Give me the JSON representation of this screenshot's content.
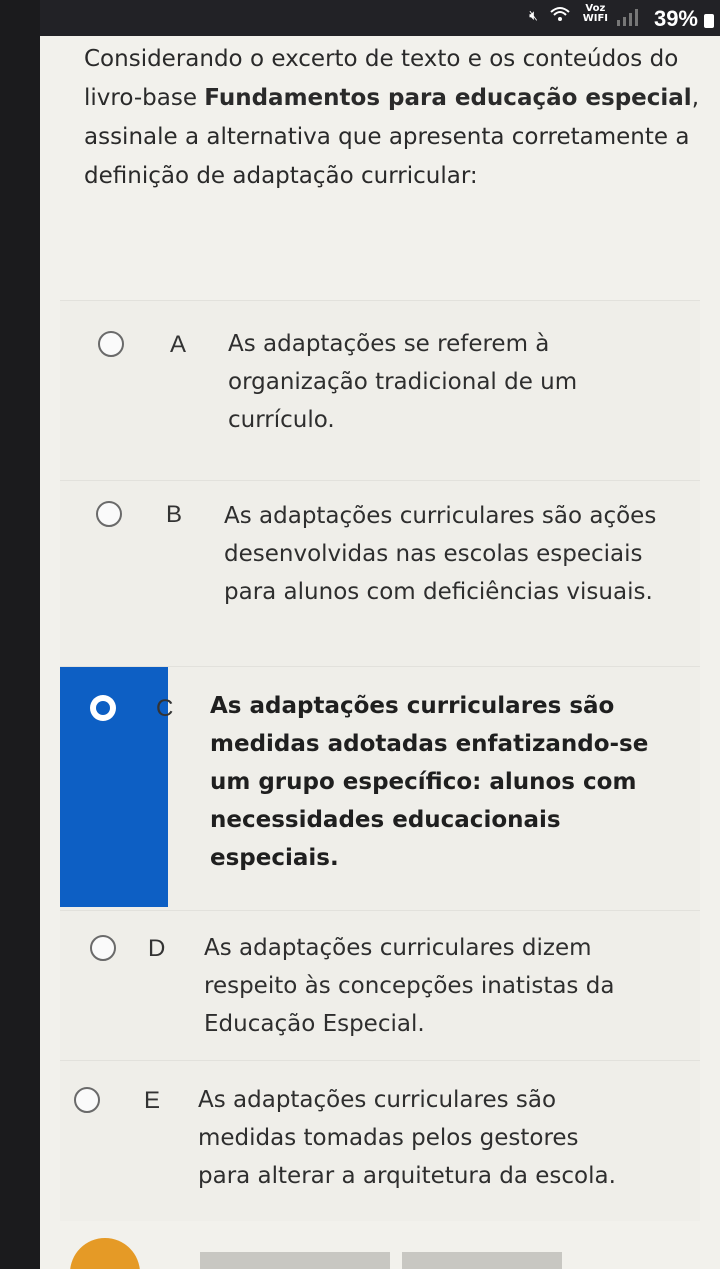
{
  "status": {
    "voz_label": "Voz",
    "wifi_label": "WIFI",
    "battery": "39%"
  },
  "question": {
    "part1": "Considerando o excerto de texto e os conteúdos do livro-base ",
    "book": "Fundamentos para educação especial",
    "part2": ", assinale a alternativa que apresenta corretamente a definição de adaptação curricular:"
  },
  "options": [
    {
      "letter": "A",
      "text": "As adaptações se referem à organização tradicional de um currículo.",
      "selected": false
    },
    {
      "letter": "B",
      "text": "As adaptações curriculares são ações desenvolvidas nas escolas especiais para alunos com deficiências visuais.",
      "selected": false
    },
    {
      "letter": "C",
      "text": "As adaptações curriculares são medidas adotadas enfatizando-se um grupo específico: alunos com necessidades educacionais especiais.",
      "selected": true
    },
    {
      "letter": "D",
      "text": "As adaptações curriculares dizem respeito às concepções inatistas da Educação Especial.",
      "selected": false
    },
    {
      "letter": "E",
      "text": "As adaptações curriculares são medidas tomadas pelos gestores para alterar a arquitetura da escola.",
      "selected": false
    }
  ],
  "colors": {
    "accent": "#0d5fc4",
    "background": "#f2f1ec"
  }
}
